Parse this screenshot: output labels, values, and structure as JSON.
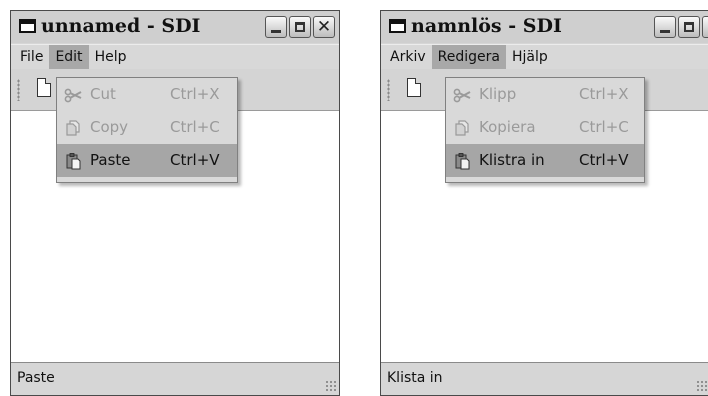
{
  "windows": [
    {
      "title": "unnamed - SDI",
      "menus": [
        "File",
        "Edit",
        "Help"
      ],
      "active_menu": 1,
      "edit_menu": [
        {
          "label": "Cut",
          "shortcut": "Ctrl+X",
          "icon": "scissors-icon",
          "state": "disabled"
        },
        {
          "label": "Copy",
          "shortcut": "Ctrl+C",
          "icon": "copy-icon",
          "state": "disabled"
        },
        {
          "label": "Paste",
          "shortcut": "Ctrl+V",
          "icon": "paste-icon",
          "state": "highlighted"
        }
      ],
      "status": "Paste"
    },
    {
      "title": "namnlös - SDI",
      "menus": [
        "Arkiv",
        "Redigera",
        "Hjälp"
      ],
      "active_menu": 1,
      "edit_menu": [
        {
          "label": "Klipp",
          "shortcut": "Ctrl+X",
          "icon": "scissors-icon",
          "state": "disabled"
        },
        {
          "label": "Kopiera",
          "shortcut": "Ctrl+C",
          "icon": "copy-icon",
          "state": "disabled"
        },
        {
          "label": "Klistra in",
          "shortcut": "Ctrl+V",
          "icon": "paste-icon",
          "state": "highlighted"
        }
      ],
      "status": "Klista in"
    }
  ],
  "colors": {
    "window_bg": "#d6d6d6",
    "menu_highlight": "#a8a8a8",
    "disabled_text": "#9a9a9a",
    "content_bg": "#ffffff"
  }
}
